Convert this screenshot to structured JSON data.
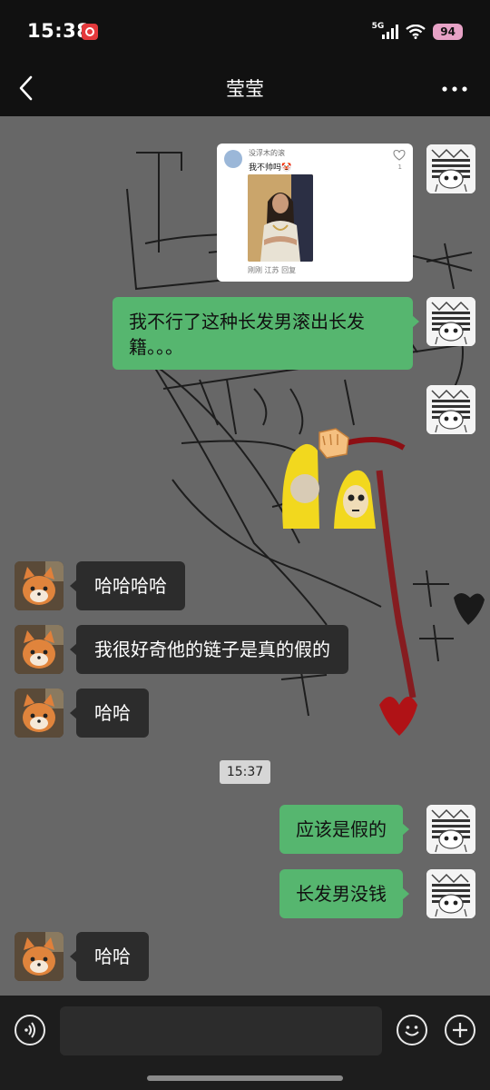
{
  "status_bar": {
    "time": "15:38",
    "network": "5G",
    "battery": "94"
  },
  "header": {
    "title": "莹莹",
    "back_icon": "chevron-left-icon",
    "more_icon": "more-dots-icon"
  },
  "shared_card": {
    "author": "没浮木的滚",
    "text": "我不帅吗🤡",
    "likes": "1",
    "footer": "刚刚 江苏 回复"
  },
  "messages": [
    {
      "sender": "me",
      "type": "card"
    },
    {
      "sender": "me",
      "type": "text",
      "text": "我不行了这种长发男滚出长发籍。。。"
    },
    {
      "sender": "me",
      "type": "sticker"
    },
    {
      "sender": "friend",
      "type": "text",
      "text": "哈哈哈哈"
    },
    {
      "sender": "friend",
      "type": "text",
      "text": "我很好奇他的链子是真的假的"
    },
    {
      "sender": "friend",
      "type": "text",
      "text": "哈哈"
    },
    {
      "sender": "system",
      "type": "time",
      "text": "15:37"
    },
    {
      "sender": "me",
      "type": "text",
      "text": "应该是假的"
    },
    {
      "sender": "me",
      "type": "text",
      "text": "长发男没钱"
    },
    {
      "sender": "friend",
      "type": "text",
      "text": "哈哈"
    }
  ],
  "input_bar": {
    "placeholder": "",
    "voice_icon": "voice-icon",
    "emoji_icon": "emoji-icon",
    "plus_icon": "plus-icon"
  },
  "colors": {
    "my_bubble": "#56b66f",
    "friend_bubble": "#2c2c2c",
    "chat_bg": "#676767"
  }
}
